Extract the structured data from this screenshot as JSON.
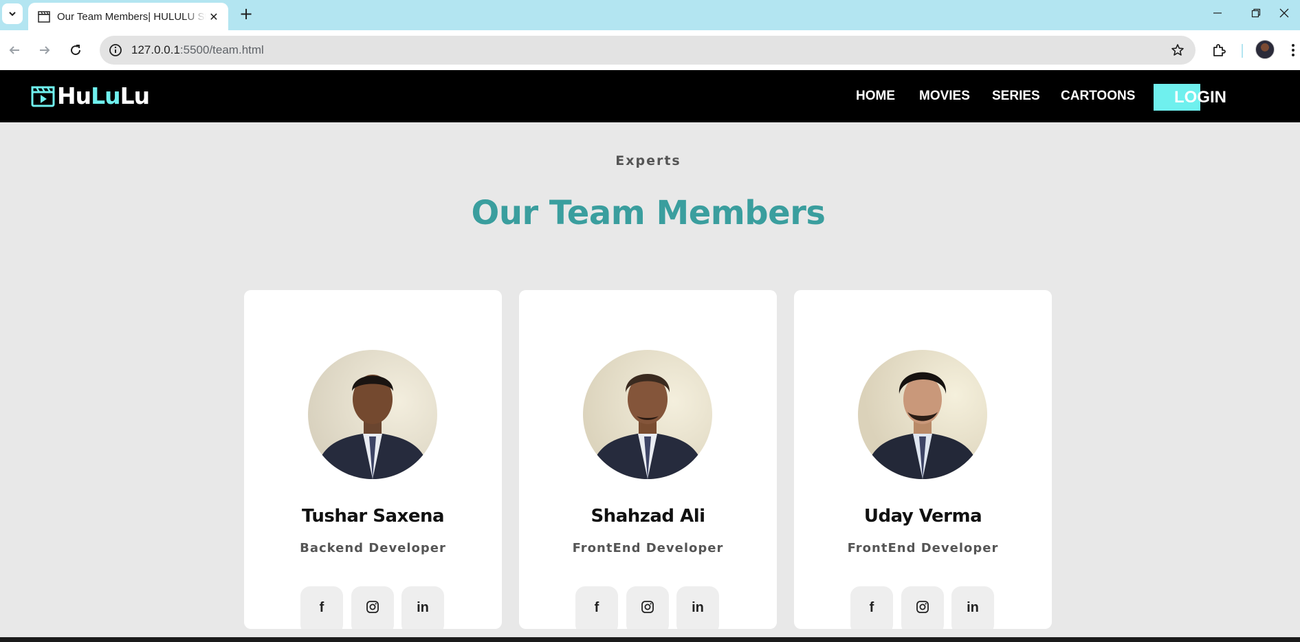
{
  "browser": {
    "tab_title": "Our Team Members| HULULU St",
    "new_tab": "+",
    "url_host": "127.0.0.1",
    "url_rest": ":5500/team.html"
  },
  "site": {
    "logo_part1": "Hu",
    "logo_part2": "Lu",
    "logo_part3": "Lu",
    "nav": {
      "home": "HOME",
      "movies": "MOVIES",
      "series": "SERIES",
      "cartoons": "CARTOONS",
      "login": "LOGIN"
    },
    "accent_color": "#6ff0ee",
    "title_color": "#3a9e9e"
  },
  "section": {
    "eyebrow": "Experts",
    "title": "Our Team Members"
  },
  "members": [
    {
      "name": "Tushar Saxena",
      "role": "Backend Developer"
    },
    {
      "name": "Shahzad Ali",
      "role": "FrontEnd Developer"
    },
    {
      "name": "Uday Verma",
      "role": "FrontEnd Developer"
    }
  ],
  "social_icons": {
    "facebook": "f",
    "linkedin": "in"
  }
}
